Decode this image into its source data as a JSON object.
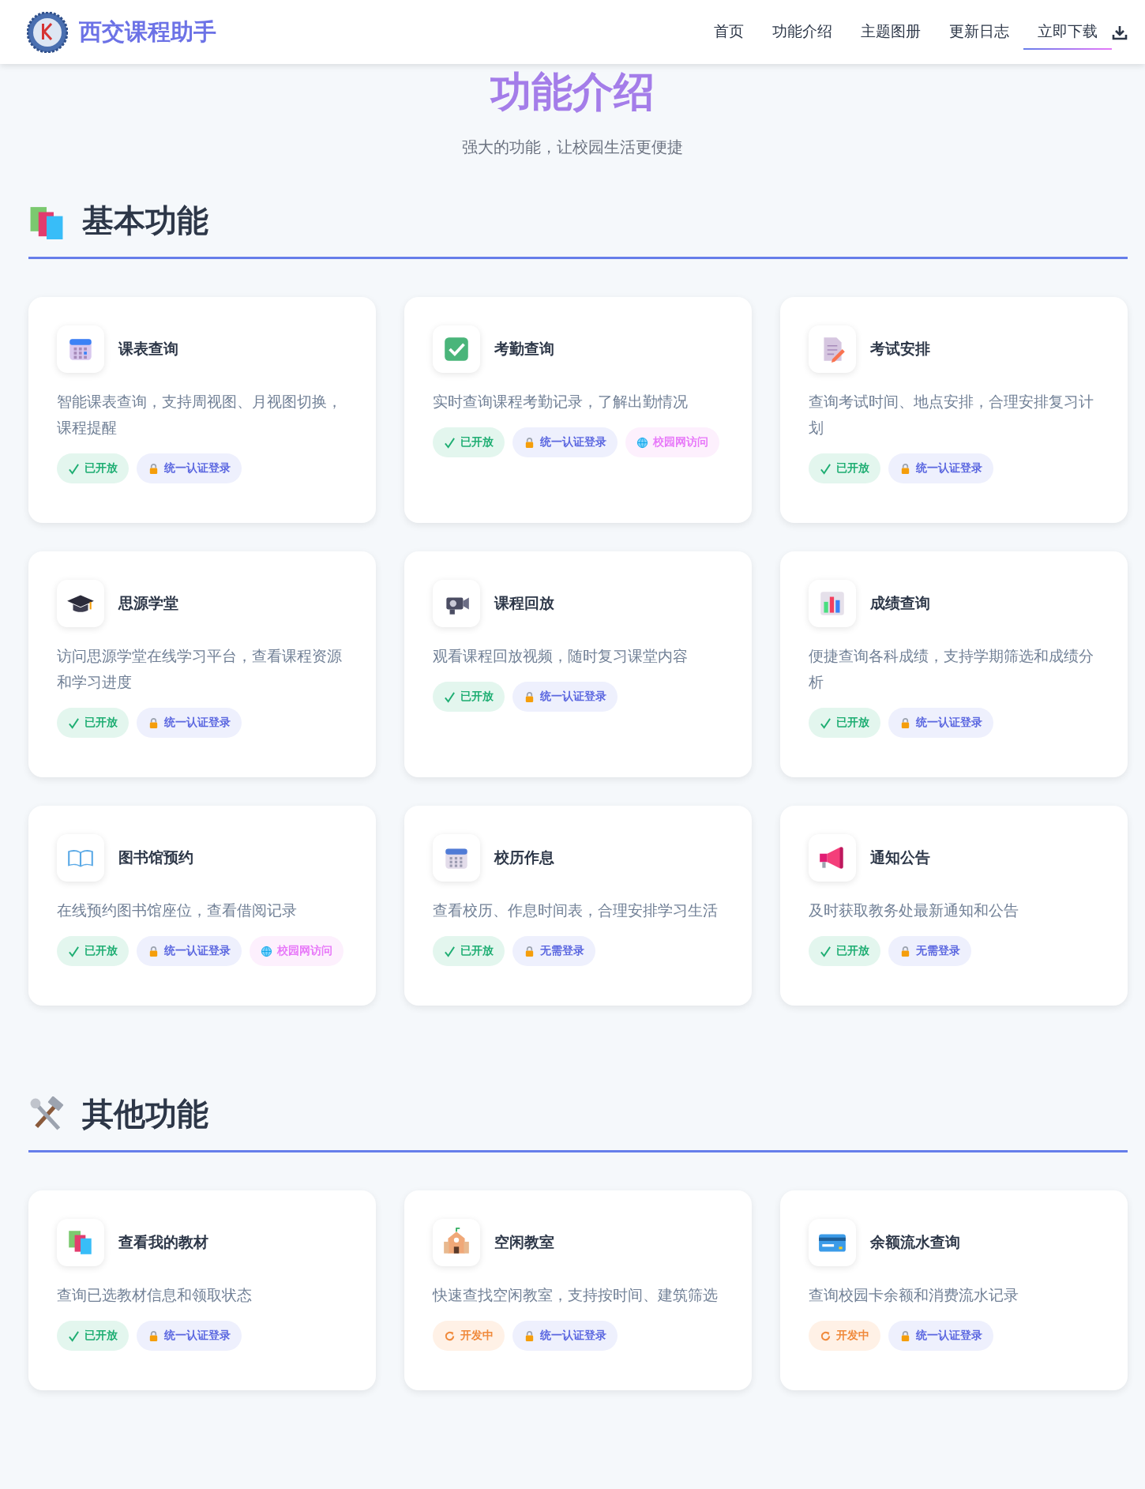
{
  "header": {
    "title": "西交课程助手",
    "nav": [
      {
        "label": "首页",
        "selected": false
      },
      {
        "label": "功能介绍",
        "selected": false
      },
      {
        "label": "主题图册",
        "selected": false
      },
      {
        "label": "更新日志",
        "selected": false
      },
      {
        "label": "立即下载",
        "selected": true
      }
    ]
  },
  "hero": {
    "title": "功能介绍",
    "subtitle": "强大的功能，让校园生活更便捷"
  },
  "sections": [
    {
      "title": "基本功能",
      "cards": [
        {
          "title": "课表查询",
          "description": "智能课表查询，支持周视图、月视图切换，课程提醒",
          "tags": [
            {
              "kind": "open",
              "label": "已开放"
            },
            {
              "kind": "login",
              "label": "统一认证登录"
            }
          ]
        },
        {
          "title": "考勤查询",
          "description": "实时查询课程考勤记录，了解出勤情况",
          "tags": [
            {
              "kind": "open",
              "label": "已开放"
            },
            {
              "kind": "login",
              "label": "统一认证登录"
            },
            {
              "kind": "campus",
              "label": "校园网访问"
            }
          ]
        },
        {
          "title": "考试安排",
          "description": "查询考试时间、地点安排，合理安排复习计划",
          "tags": [
            {
              "kind": "open",
              "label": "已开放"
            },
            {
              "kind": "login",
              "label": "统一认证登录"
            }
          ]
        },
        {
          "title": "思源学堂",
          "description": "访问思源学堂在线学习平台，查看课程资源和学习进度",
          "tags": [
            {
              "kind": "open",
              "label": "已开放"
            },
            {
              "kind": "login",
              "label": "统一认证登录"
            }
          ]
        },
        {
          "title": "课程回放",
          "description": "观看课程回放视频，随时复习课堂内容",
          "tags": [
            {
              "kind": "open",
              "label": "已开放"
            },
            {
              "kind": "login",
              "label": "统一认证登录"
            }
          ]
        },
        {
          "title": "成绩查询",
          "description": "便捷查询各科成绩，支持学期筛选和成绩分析",
          "tags": [
            {
              "kind": "open",
              "label": "已开放"
            },
            {
              "kind": "login",
              "label": "统一认证登录"
            }
          ]
        },
        {
          "title": "图书馆预约",
          "description": "在线预约图书馆座位，查看借阅记录",
          "tags": [
            {
              "kind": "open",
              "label": "已开放"
            },
            {
              "kind": "login",
              "label": "统一认证登录"
            },
            {
              "kind": "campus",
              "label": "校园网访问"
            }
          ]
        },
        {
          "title": "校历作息",
          "description": "查看校历、作息时间表，合理安排学习生活",
          "tags": [
            {
              "kind": "open",
              "label": "已开放"
            },
            {
              "kind": "login",
              "label": "无需登录"
            }
          ]
        },
        {
          "title": "通知公告",
          "description": "及时获取教务处最新通知和公告",
          "tags": [
            {
              "kind": "open",
              "label": "已开放"
            },
            {
              "kind": "login",
              "label": "无需登录"
            }
          ]
        }
      ]
    },
    {
      "title": "其他功能",
      "cards": [
        {
          "title": "查看我的教材",
          "description": "查询已选教材信息和领取状态",
          "tags": [
            {
              "kind": "open",
              "label": "已开放"
            },
            {
              "kind": "login",
              "label": "统一认证登录"
            }
          ]
        },
        {
          "title": "空闲教室",
          "description": "快速查找空闲教室，支持按时间、建筑筛选",
          "tags": [
            {
              "kind": "dev",
              "label": "开发中"
            },
            {
              "kind": "login",
              "label": "统一认证登录"
            }
          ]
        },
        {
          "title": "余额流水查询",
          "description": "查询校园卡余额和消费流水记录",
          "tags": [
            {
              "kind": "dev",
              "label": "开发中"
            },
            {
              "kind": "login",
              "label": "统一认证登录"
            }
          ]
        }
      ]
    }
  ]
}
